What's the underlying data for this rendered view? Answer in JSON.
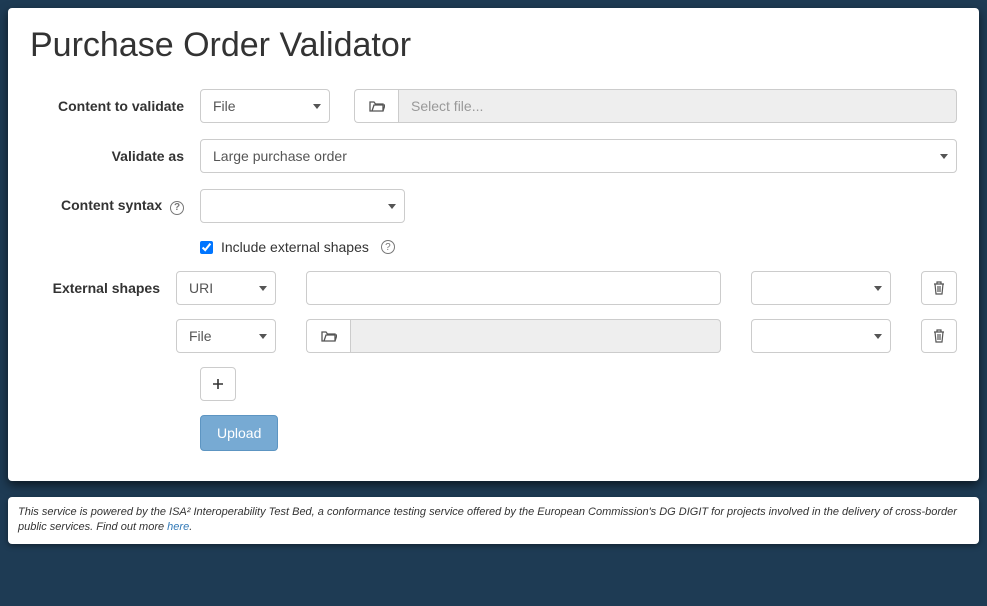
{
  "title": "Purchase Order Validator",
  "labels": {
    "content_to_validate": "Content to validate",
    "validate_as": "Validate as",
    "content_syntax": "Content syntax",
    "include_external": "Include external shapes",
    "external_shapes": "External shapes"
  },
  "content_source": {
    "selected": "File",
    "file_placeholder": "Select file..."
  },
  "validate_as": {
    "selected": "Large purchase order"
  },
  "content_syntax": {
    "selected": ""
  },
  "include_external_checked": true,
  "external_shapes": {
    "rows": [
      {
        "source": "URI",
        "value": "",
        "syntax": ""
      },
      {
        "source": "File",
        "file": "",
        "syntax": ""
      }
    ]
  },
  "buttons": {
    "upload": "Upload"
  },
  "footer": {
    "text": "This service is powered by the ISA² Interoperability Test Bed, a conformance testing service offered by the European Commission's DG DIGIT for projects involved in the delivery of cross-border public services. Find out more ",
    "link_text": "here",
    "suffix": "."
  }
}
